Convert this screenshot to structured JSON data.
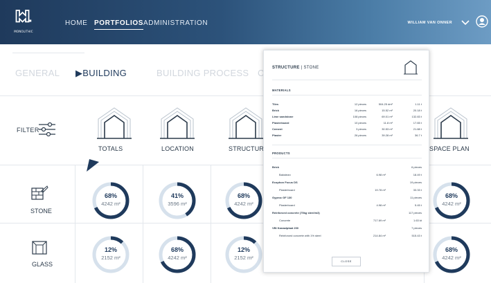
{
  "header": {
    "logo_text": "MONOLITHIC",
    "nav": {
      "home": "HOME",
      "portfolios": "PORTFOLIOS",
      "administration": "ADMINISTRATION"
    },
    "user_name": "WILLIAM VAN ONNER"
  },
  "tabs": {
    "general": "GENERAL",
    "building": "▶BUILDING",
    "building_process": "BUILDING PROCESS",
    "partial": "C"
  },
  "filter_label": "FILTER",
  "categories": [
    "TOTALS",
    "LOCATION",
    "STRUCTURE",
    "SPACE PLAN"
  ],
  "rows": [
    {
      "label": "STONE",
      "donuts": [
        {
          "pct": "68%",
          "area": "4242 m²",
          "fraction": 0.68
        },
        {
          "pct": "41%",
          "area": "3596 m²",
          "fraction": 0.41
        },
        {
          "pct": "68%",
          "area": "4242 m²",
          "fraction": 0.68
        },
        {
          "pct": "68%",
          "area": "4242 m²",
          "fraction": 0.68
        }
      ]
    },
    {
      "label": "GLASS",
      "donuts": [
        {
          "pct": "12%",
          "area": "2152 m²",
          "fraction": 0.12
        },
        {
          "pct": "68%",
          "area": "4242 m²",
          "fraction": 0.68
        },
        {
          "pct": "12%",
          "area": "2152 m²",
          "fraction": 0.12
        },
        {
          "pct": "68%",
          "area": "4242 m²",
          "fraction": 0.68
        }
      ]
    }
  ],
  "popup": {
    "title_bold": "STRUCTURE",
    "title_rest": " | STONE",
    "materials_title": "MATERIALS",
    "materials": [
      {
        "name": "Tiles",
        "qty": "12 pieces",
        "area": "504.25 dm²",
        "weight": "1.11 t"
      },
      {
        "name": "Brick",
        "qty": "16 pieces",
        "area": "15.52 m²",
        "weight": "20.18 t"
      },
      {
        "name": "Lime sandstone",
        "qty": "108 pieces",
        "area": "69.01 m²",
        "weight": "132.83 t"
      },
      {
        "name": "Plasterboard",
        "qty": "10 pieces",
        "area": "11.8 m²",
        "weight": "17.65 t"
      },
      {
        "name": "Cement",
        "qty": "3 pieces",
        "area": "30.53 m²",
        "weight": "21.88 t"
      },
      {
        "name": "Plaster",
        "qty": "26 pieces",
        "area": "39.28 m²",
        "weight": "36.7 t"
      }
    ],
    "products_title": "PRODUCTS",
    "products": [
      {
        "name": "Brick",
        "count": "6 pieces",
        "sub": {
          "name": "Bakstean",
          "area": "6.98 m²",
          "weight": "18.49 t"
        }
      },
      {
        "name": "Ecophon Focus DS",
        "count": "19 pieces",
        "sub": {
          "name": "Plasterboard",
          "area": "19.78 m²",
          "weight": "33.33 t"
        }
      },
      {
        "name": "Gyproc GF 130",
        "count": "11 pieces",
        "sub": {
          "name": "Plasterboard",
          "area": "4.98 m²",
          "weight": "5.45 t"
        }
      },
      {
        "name": "Reinforced concrete (75kg steel/m3)",
        "count": "117 pieces",
        "sub": {
          "name": "Concrete",
          "area": "717.69 m²",
          "weight": "1.63 kt"
        }
      },
      {
        "name": "VBI Kanaalplaat 200",
        "count": "7 pieces",
        "sub": {
          "name": "Reinforced concrete with 1% steel",
          "area": "214.84 m²",
          "weight": "515.43 t"
        }
      }
    ],
    "close_label": "CLOSE"
  },
  "colors": {
    "header_dark": "#1f3a5c",
    "donut_fill": "#1f3a5c",
    "donut_track": "#d6e1ec"
  },
  "icons": [
    "logo-icon",
    "chevron-down-icon",
    "user-icon",
    "filter-sliders-icon",
    "house-icon",
    "stone-wall-icon",
    "window-icon",
    "pointer-arrow-icon"
  ]
}
